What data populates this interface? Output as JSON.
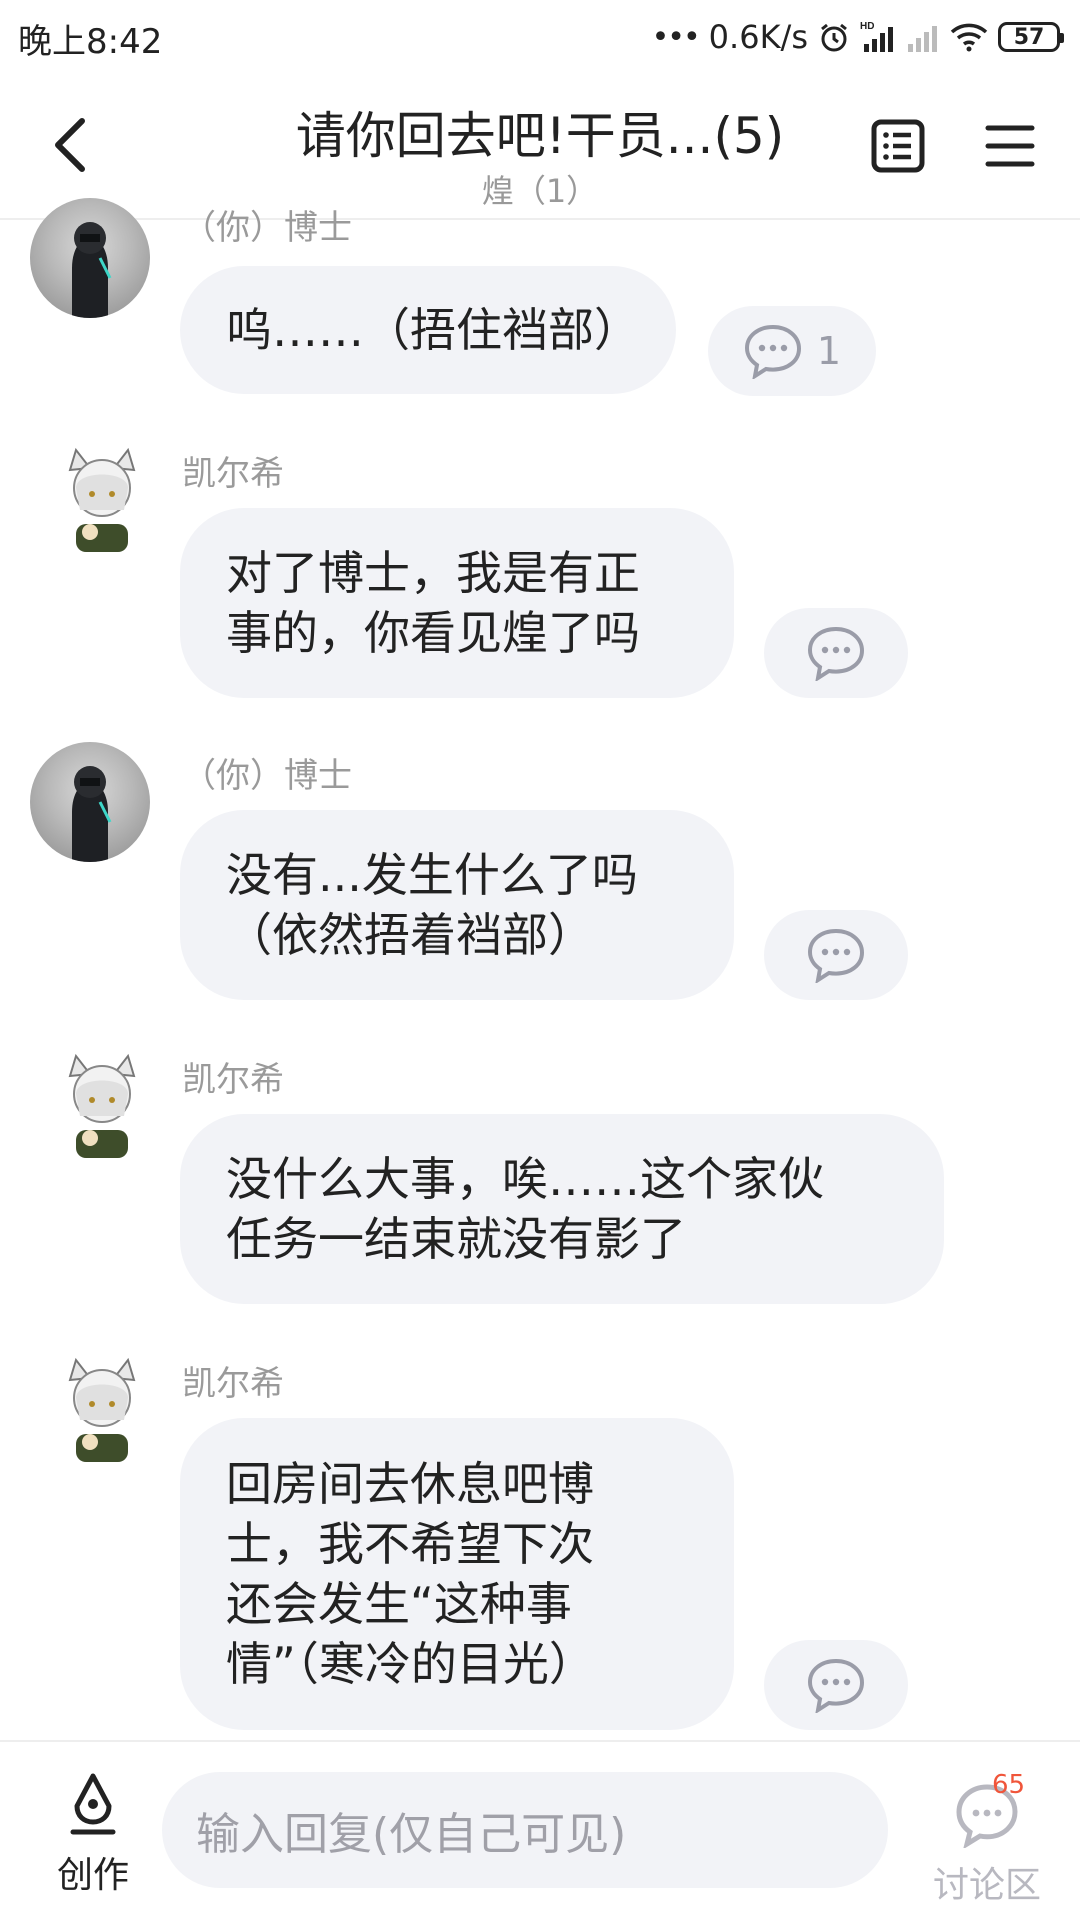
{
  "status_bar": {
    "time": "晚上8:42",
    "network_speed": "0.6K/s",
    "battery": "57"
  },
  "header": {
    "title": "请你回去吧!干员...(5)",
    "subtitle": "煌（1）"
  },
  "messages": [
    {
      "sender": "（你）博士",
      "lines": [
        "呜……（捂住裆部）"
      ],
      "comment_count": "1"
    },
    {
      "sender": "凯尔希",
      "lines": [
        "对了博士，我是有正",
        "事的，你看见煌了吗"
      ],
      "comment_count": ""
    },
    {
      "sender": "（你）博士",
      "lines": [
        "没有...发生什么了吗",
        "（依然捂着裆部）"
      ],
      "comment_count": ""
    },
    {
      "sender": "凯尔希",
      "lines": [
        "没什么大事，唉……这个家伙",
        "任务一结束就没有影了"
      ],
      "comment_count": ""
    },
    {
      "sender": "凯尔希",
      "lines": [
        "回房间去休息吧博",
        "士，我不希望下次",
        "还会发生“这种事",
        "情”（寒冷的目光）"
      ],
      "comment_count": ""
    }
  ],
  "bottom_bar": {
    "create_label": "创作",
    "reply_placeholder": "输入回复(仅自己可见)",
    "discuss_label": "讨论区",
    "discuss_badge": "65"
  },
  "colors": {
    "bubble": "#f2f3f7",
    "muted_text": "#9a9a9a",
    "badge": "#f0553a"
  }
}
